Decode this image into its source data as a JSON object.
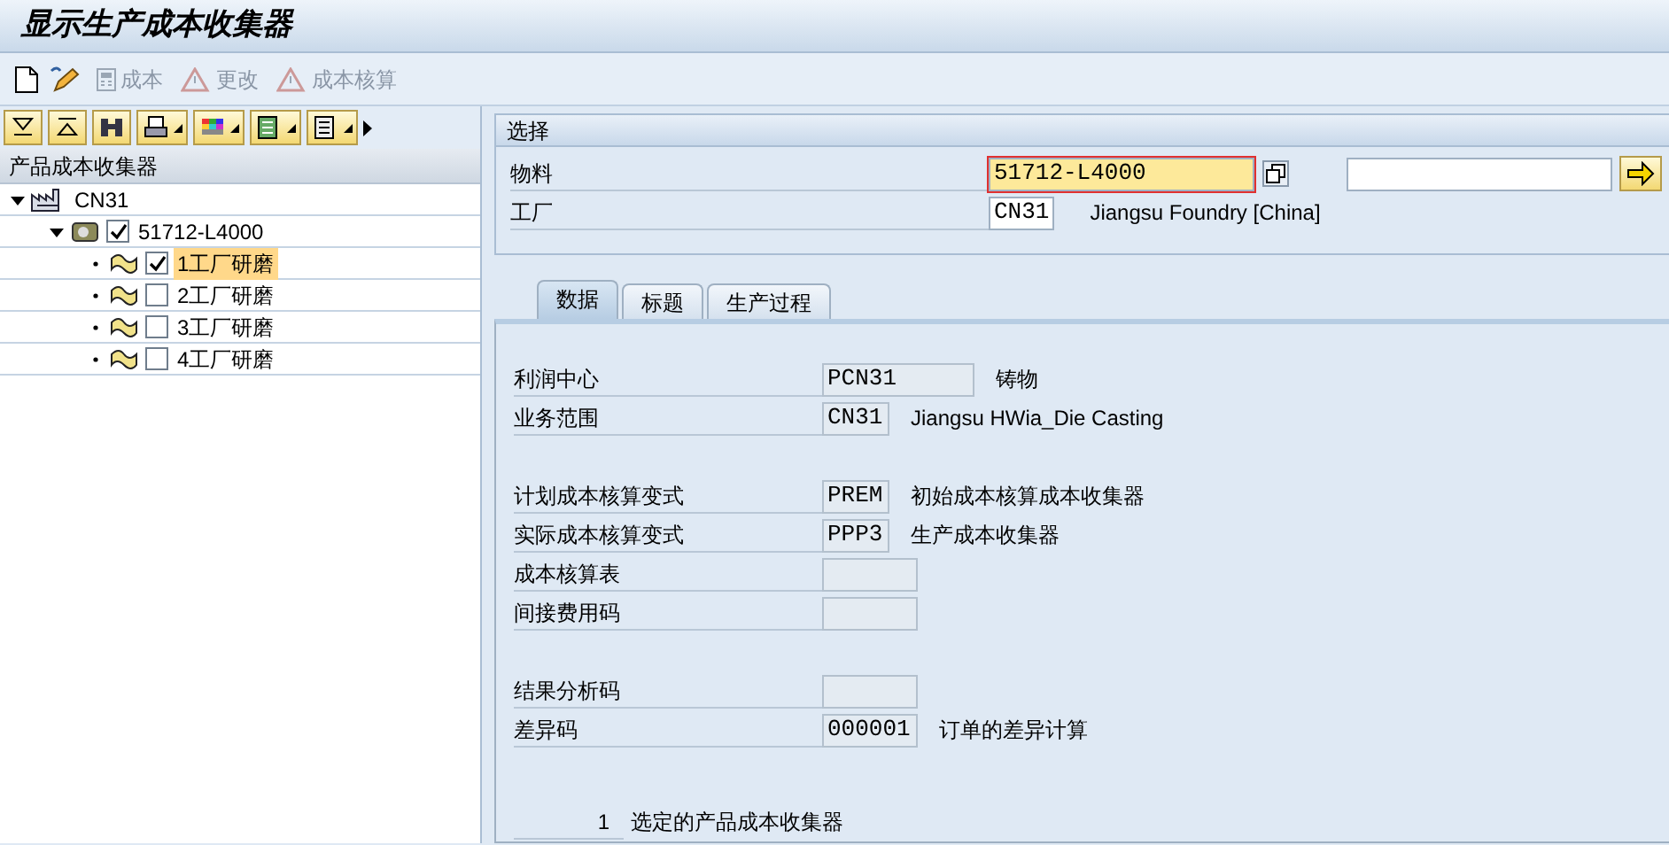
{
  "window": {
    "title": "显示生产成本收集器"
  },
  "toolbar": [
    {
      "label": "成本",
      "disabled": true
    },
    {
      "label": "更改",
      "disabled": true
    },
    {
      "label": "成本核算",
      "disabled": true
    }
  ],
  "tree": {
    "header": "产品成本收集器",
    "items": [
      {
        "label": "CN31",
        "kind": "plant",
        "expanded": true,
        "children": [
          {
            "label": "51712-L4000",
            "kind": "material",
            "expanded": true,
            "checked": true,
            "selected": false,
            "children": [
              {
                "label": "1工厂研磨",
                "kind": "collector",
                "checked": true,
                "selected": true
              },
              {
                "label": "2工厂研磨",
                "kind": "collector",
                "checked": false,
                "selected": false
              },
              {
                "label": "3工厂研磨",
                "kind": "collector",
                "checked": false,
                "selected": false
              },
              {
                "label": "4工厂研磨",
                "kind": "collector",
                "checked": false,
                "selected": false
              }
            ]
          }
        ]
      }
    ]
  },
  "selection": {
    "title": "选择",
    "fields": [
      {
        "label": "物料",
        "value": "51712-L4000",
        "focused": true
      },
      {
        "label": "工厂",
        "value": "CN31",
        "focused": false,
        "description": "Jiangsu Foundry [China]"
      }
    ]
  },
  "tabs": [
    {
      "label": "数据",
      "selected": true
    },
    {
      "label": "标题",
      "selected": false
    },
    {
      "label": "生产过程",
      "selected": false
    }
  ],
  "data_groups": [
    {
      "fields": [
        {
          "label": "利润中心",
          "value": "PCN31",
          "description": "铸物"
        },
        {
          "label": "业务范围",
          "value": "CN31",
          "description": "Jiangsu HWia_Die Casting"
        }
      ]
    },
    {
      "fields": [
        {
          "label": "计划成本核算变式",
          "value": "PREM",
          "description": "初始成本核算成本收集器"
        },
        {
          "label": "实际成本核算变式",
          "value": "PPP3",
          "description": "生产成本收集器"
        },
        {
          "label": "成本核算表"
        },
        {
          "label": "间接费用码"
        }
      ]
    },
    {
      "fields": [
        {
          "label": "结果分析码"
        },
        {
          "label": "差异码",
          "value": "000001",
          "description": "订单的差异计算"
        }
      ]
    }
  ],
  "summary": {
    "count": "1",
    "label": "选定的产品成本收集器"
  }
}
